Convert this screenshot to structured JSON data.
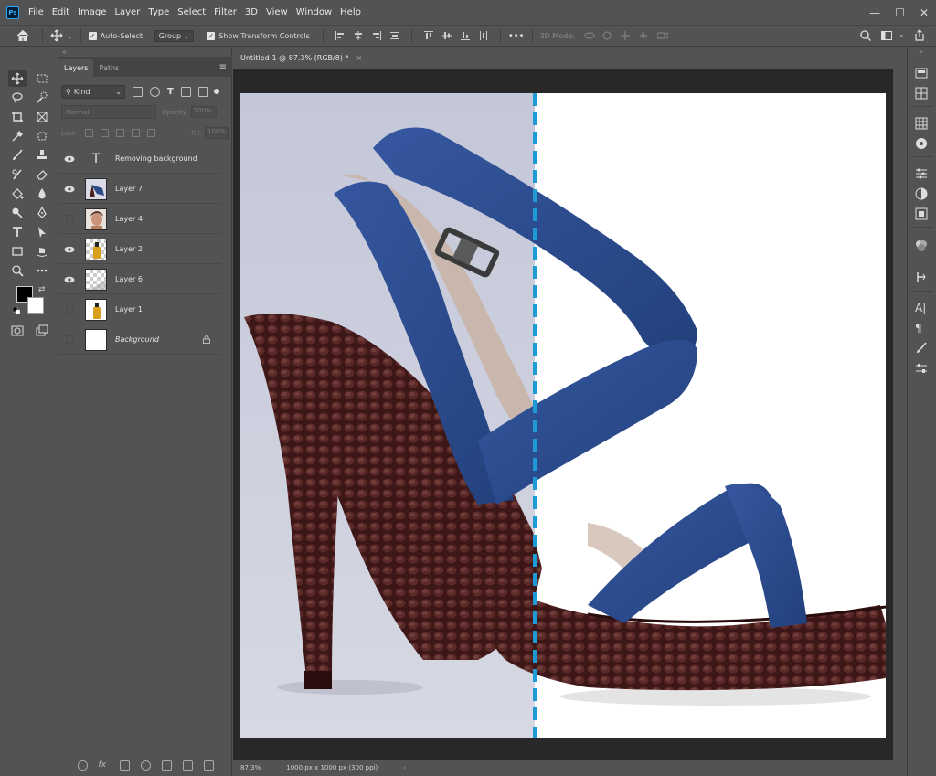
{
  "app": {
    "logo_text": "Ps",
    "menu": [
      "File",
      "Edit",
      "Image",
      "Layer",
      "Type",
      "Select",
      "Filter",
      "3D",
      "View",
      "Window",
      "Help"
    ],
    "window_controls": [
      "—",
      "☐",
      "✕"
    ]
  },
  "options_bar": {
    "auto_select_label": "Auto-Select:",
    "auto_select_checked": true,
    "auto_select_target": "Group",
    "show_transform_label": "Show Transform Controls",
    "show_transform_checked": true,
    "more_label": "•••",
    "mode_3d_label": "3D Mode:"
  },
  "layers_panel": {
    "tabs": [
      "Layers",
      "Paths"
    ],
    "active_tab": "Layers",
    "filter_kind": "Kind",
    "blend_mode": "Normal",
    "opacity_label": "Opacity:",
    "opacity_value": "100%",
    "lock_label": "Lock:",
    "fill_label": "Fill:",
    "fill_value": "100%",
    "layers": [
      {
        "name": "Removing background",
        "visible": true,
        "type": "text"
      },
      {
        "name": "Layer 7",
        "visible": true,
        "type": "shoe"
      },
      {
        "name": "Layer 4",
        "visible": false,
        "type": "portrait"
      },
      {
        "name": "Layer 2",
        "visible": true,
        "type": "bottle-transparent"
      },
      {
        "name": "Layer 6",
        "visible": true,
        "type": "transparent"
      },
      {
        "name": "Layer 1",
        "visible": false,
        "type": "bottle"
      },
      {
        "name": "Background",
        "visible": false,
        "type": "background",
        "locked": true
      }
    ]
  },
  "document": {
    "tab_title": "Untitled-1 @ 87.3% (RGB/8) *",
    "zoom": "87.3%",
    "dimensions": "1000 px x 1000 px (300 ppi)",
    "divider_color": "#1e9bd7",
    "left_background": "#c9ccdc",
    "strap_color": "#2b4a86",
    "heel_color": "#4a2020"
  }
}
